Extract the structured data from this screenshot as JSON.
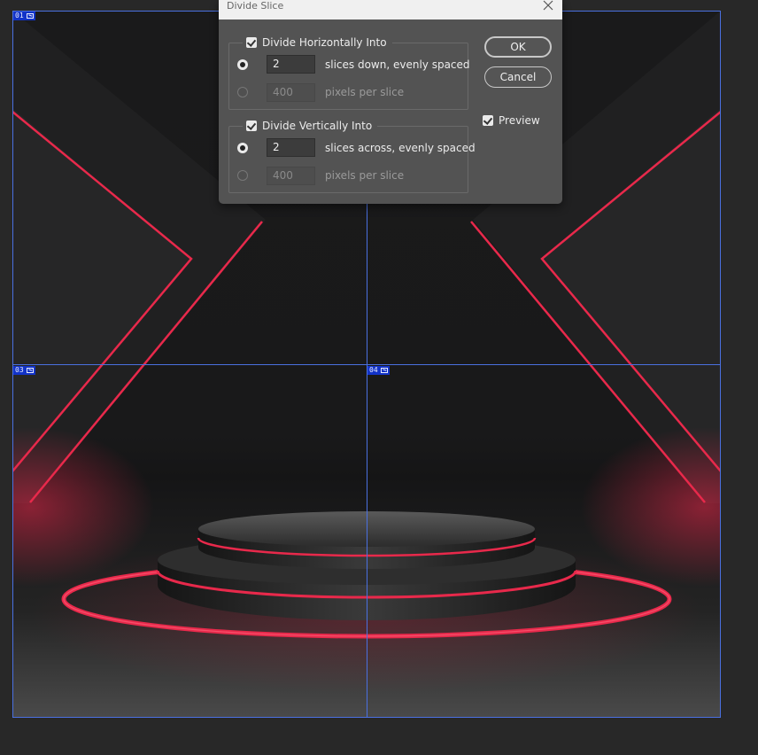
{
  "canvas": {
    "slices": [
      {
        "label": "01",
        "icon": "image-slice-icon"
      },
      {
        "label": "03",
        "icon": "image-slice-icon"
      },
      {
        "label": "04",
        "icon": "image-slice-icon"
      }
    ],
    "accent_color": "#e8294b",
    "slice_line_color": "#4a70e0"
  },
  "dialog": {
    "title": "Divide Slice",
    "horizontal": {
      "checkbox_label": "Divide Horizontally Into",
      "checked": true,
      "count_value": "2",
      "count_label": "slices down, evenly spaced",
      "pixels_value": "400",
      "pixels_label": "pixels per slice",
      "selected": "count"
    },
    "vertical": {
      "checkbox_label": "Divide Vertically Into",
      "checked": true,
      "count_value": "2",
      "count_label": "slices across, evenly spaced",
      "pixels_value": "400",
      "pixels_label": "pixels per slice",
      "selected": "count"
    },
    "ok_label": "OK",
    "cancel_label": "Cancel",
    "preview_label": "Preview",
    "preview_checked": true
  }
}
